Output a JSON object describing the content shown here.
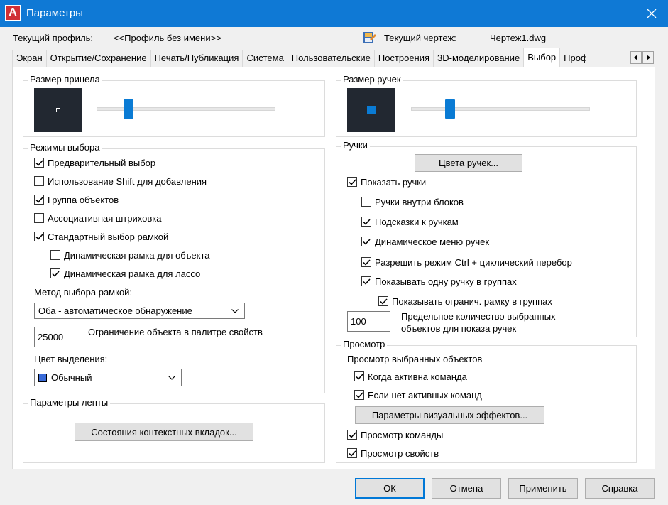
{
  "window": {
    "title": "Параметры"
  },
  "profile": {
    "label": "Текущий профиль:",
    "value": "<<Профиль без имени>>",
    "drawing_label": "Текущий чертеж:",
    "drawing_value": "Чертеж1.dwg"
  },
  "tabs": [
    {
      "label": "Экран"
    },
    {
      "label": "Открытие/Сохранение"
    },
    {
      "label": "Печать/Публикация"
    },
    {
      "label": "Система"
    },
    {
      "label": "Пользовательские"
    },
    {
      "label": "Построения"
    },
    {
      "label": "3D-моделирование"
    },
    {
      "label": "Выбор",
      "active": true
    },
    {
      "label": "Проф"
    }
  ],
  "left": {
    "pickbox": {
      "title": "Размер прицела",
      "slider_level": 0.18
    },
    "modes": {
      "title": "Режимы выбора",
      "items": [
        {
          "label": "Предварительный выбор",
          "checked": true
        },
        {
          "label": "Использование Shift для добавления",
          "checked": false
        },
        {
          "label": "Группа объектов",
          "checked": true
        },
        {
          "label": "Ассоциативная штриховка",
          "checked": false
        },
        {
          "label": "Стандартный выбор рамкой",
          "checked": true
        },
        {
          "label": "Динамическая рамка для объекта",
          "checked": false
        },
        {
          "label": "Динамическая рамка для лассо",
          "checked": true
        }
      ],
      "method_label": "Метод выбора рамкой:",
      "method_value": "Оба - автоматическое обнаружение",
      "limit_value": "25000",
      "limit_label": "Ограничение объекта в палитре свойств",
      "color_label": "Цвет выделения:",
      "color_value": "Обычный",
      "color_swatch": "#3a6bd8"
    },
    "ribbon": {
      "title": "Параметры ленты",
      "button": "Состояния контекстных вкладок..."
    }
  },
  "right": {
    "gripsize": {
      "title": "Размер ручек",
      "slider_level": 0.22
    },
    "grips": {
      "title": "Ручки",
      "colors_button": "Цвета ручек...",
      "items": [
        {
          "label": "Показать ручки",
          "checked": true
        },
        {
          "label": "Ручки внутри блоков",
          "checked": false
        },
        {
          "label": "Подсказки к ручкам",
          "checked": true
        },
        {
          "label": "Динамическое меню ручек",
          "checked": true
        },
        {
          "label": "Разрешить режим Ctrl + циклический перебор",
          "checked": true
        },
        {
          "label": "Показывать одну ручку в группах",
          "checked": true
        },
        {
          "label": "Показывать огранич. рамку в группах",
          "checked": true
        }
      ],
      "limit_value": "100",
      "limit_label_1": "Предельное количество выбранных",
      "limit_label_2": "объектов для показа ручек"
    },
    "preview": {
      "title": "Просмотр",
      "subtitle": "Просмотр выбранных объектов",
      "items": [
        {
          "label": "Когда активна команда",
          "checked": true
        },
        {
          "label": "Если нет активных команд",
          "checked": true
        },
        {
          "label": "Просмотр команды",
          "checked": true
        },
        {
          "label": "Просмотр свойств",
          "checked": true
        }
      ],
      "effects_button": "Параметры визуальных эффектов..."
    }
  },
  "footer": {
    "ok": "ОК",
    "cancel": "Отмена",
    "apply": "Применить",
    "help": "Справка"
  },
  "colors": {
    "titlebar": "#0f79d5",
    "accent": "#0a7bd4",
    "grip": "#0a7bd4"
  }
}
